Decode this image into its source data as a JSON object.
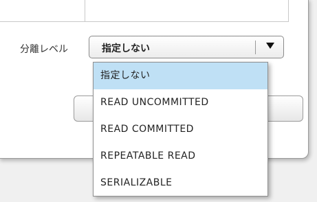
{
  "isolation": {
    "label": "分離レベル",
    "selected_value": "指定しない",
    "options": [
      {
        "label": "指定しない",
        "selected": true
      },
      {
        "label": "READ UNCOMMITTED",
        "selected": false
      },
      {
        "label": "READ COMMITTED",
        "selected": false
      },
      {
        "label": "REPEATABLE READ",
        "selected": false
      },
      {
        "label": "SERIALIZABLE",
        "selected": false
      }
    ]
  },
  "colors": {
    "highlight": "#bfe0f5",
    "panel_bg": "#ffffff",
    "page_bg": "#f0f0f0"
  },
  "icons": {
    "dropdown_arrow": "chevron-down-icon"
  }
}
